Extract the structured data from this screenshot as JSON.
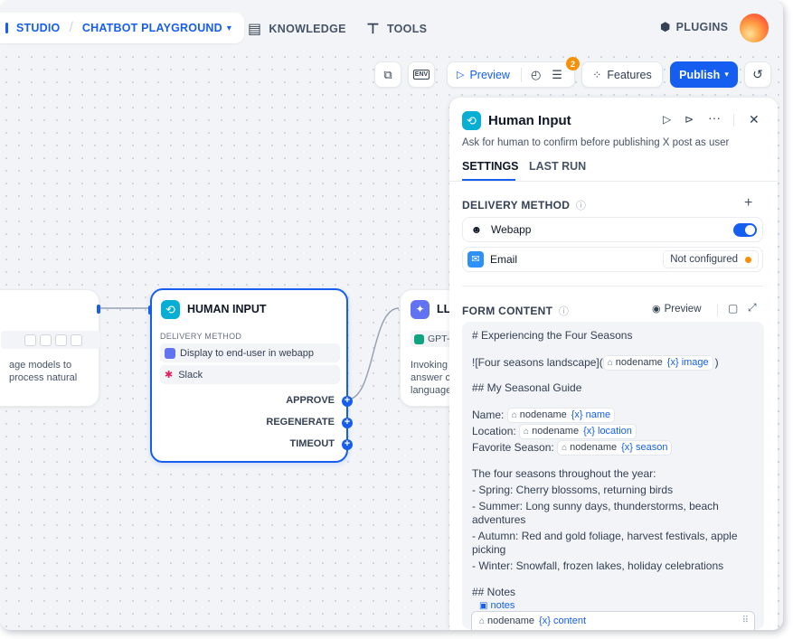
{
  "header": {
    "studio": "STUDIO",
    "app": "CHATBOT PLAYGROUND",
    "knowledge": "KNOWLEDGE",
    "tools": "TOOLS",
    "plugins": "PLUGINS"
  },
  "toolbar": {
    "preview": "Preview",
    "badge": "2",
    "features": "Features",
    "publish": "Publish",
    "env": "ENV"
  },
  "left_node": {
    "text_line1": "age models to",
    "text_line2": "process natural"
  },
  "human_node": {
    "title": "HUMAN INPUT",
    "section": "DELIVERY METHOD",
    "methods": [
      "Display to end-user in webapp",
      "Slack"
    ],
    "outputs": [
      "APPROVE",
      "REGENERATE",
      "TIMEOUT"
    ]
  },
  "llm_node": {
    "title": "LL",
    "model": "GPT-",
    "desc_lines": [
      "Invoking",
      "answer c",
      "language"
    ]
  },
  "panel": {
    "title": "Human Input",
    "description": "Ask for human to confirm before publishing X post as user",
    "tabs": [
      "SETTINGS",
      "LAST RUN"
    ],
    "delivery_label": "DELIVERY METHOD",
    "webapp": "Webapp",
    "email": "Email",
    "email_status": "Not configured",
    "form_label": "FORM CONTENT",
    "form_preview": "Preview",
    "editor": {
      "l1": "# Experiencing the Four Seasons",
      "l2_pre": "![Four seasons landscape](",
      "l2_post": ")",
      "l3": "## My Seasonal Guide",
      "name_label": "Name:",
      "location_label": "Location:",
      "season_label": "Favorite Season:",
      "nodename": "nodename",
      "var_image": "{x} image",
      "var_name": "{x} name",
      "var_location": "{x} location",
      "var_season": "{x} season",
      "intro": "The four seasons throughout the year:",
      "spring": "- Spring: Cherry blossoms, returning birds",
      "summer1": "- Summer: Long sunny days, thunderstorms, beach",
      "summer2": "adventures",
      "autumn1": "- Autumn: Red and gold foliage, harvest festivals, apple",
      "autumn2": "picking",
      "winter": "- Winter: Snowfall, frozen lakes, holiday celebrations",
      "notes_heading": "## Notes",
      "notes_tag": "notes",
      "var_content": "{x} content"
    }
  },
  "colors": {
    "accent": "#155eef",
    "warning": "#f79009"
  }
}
